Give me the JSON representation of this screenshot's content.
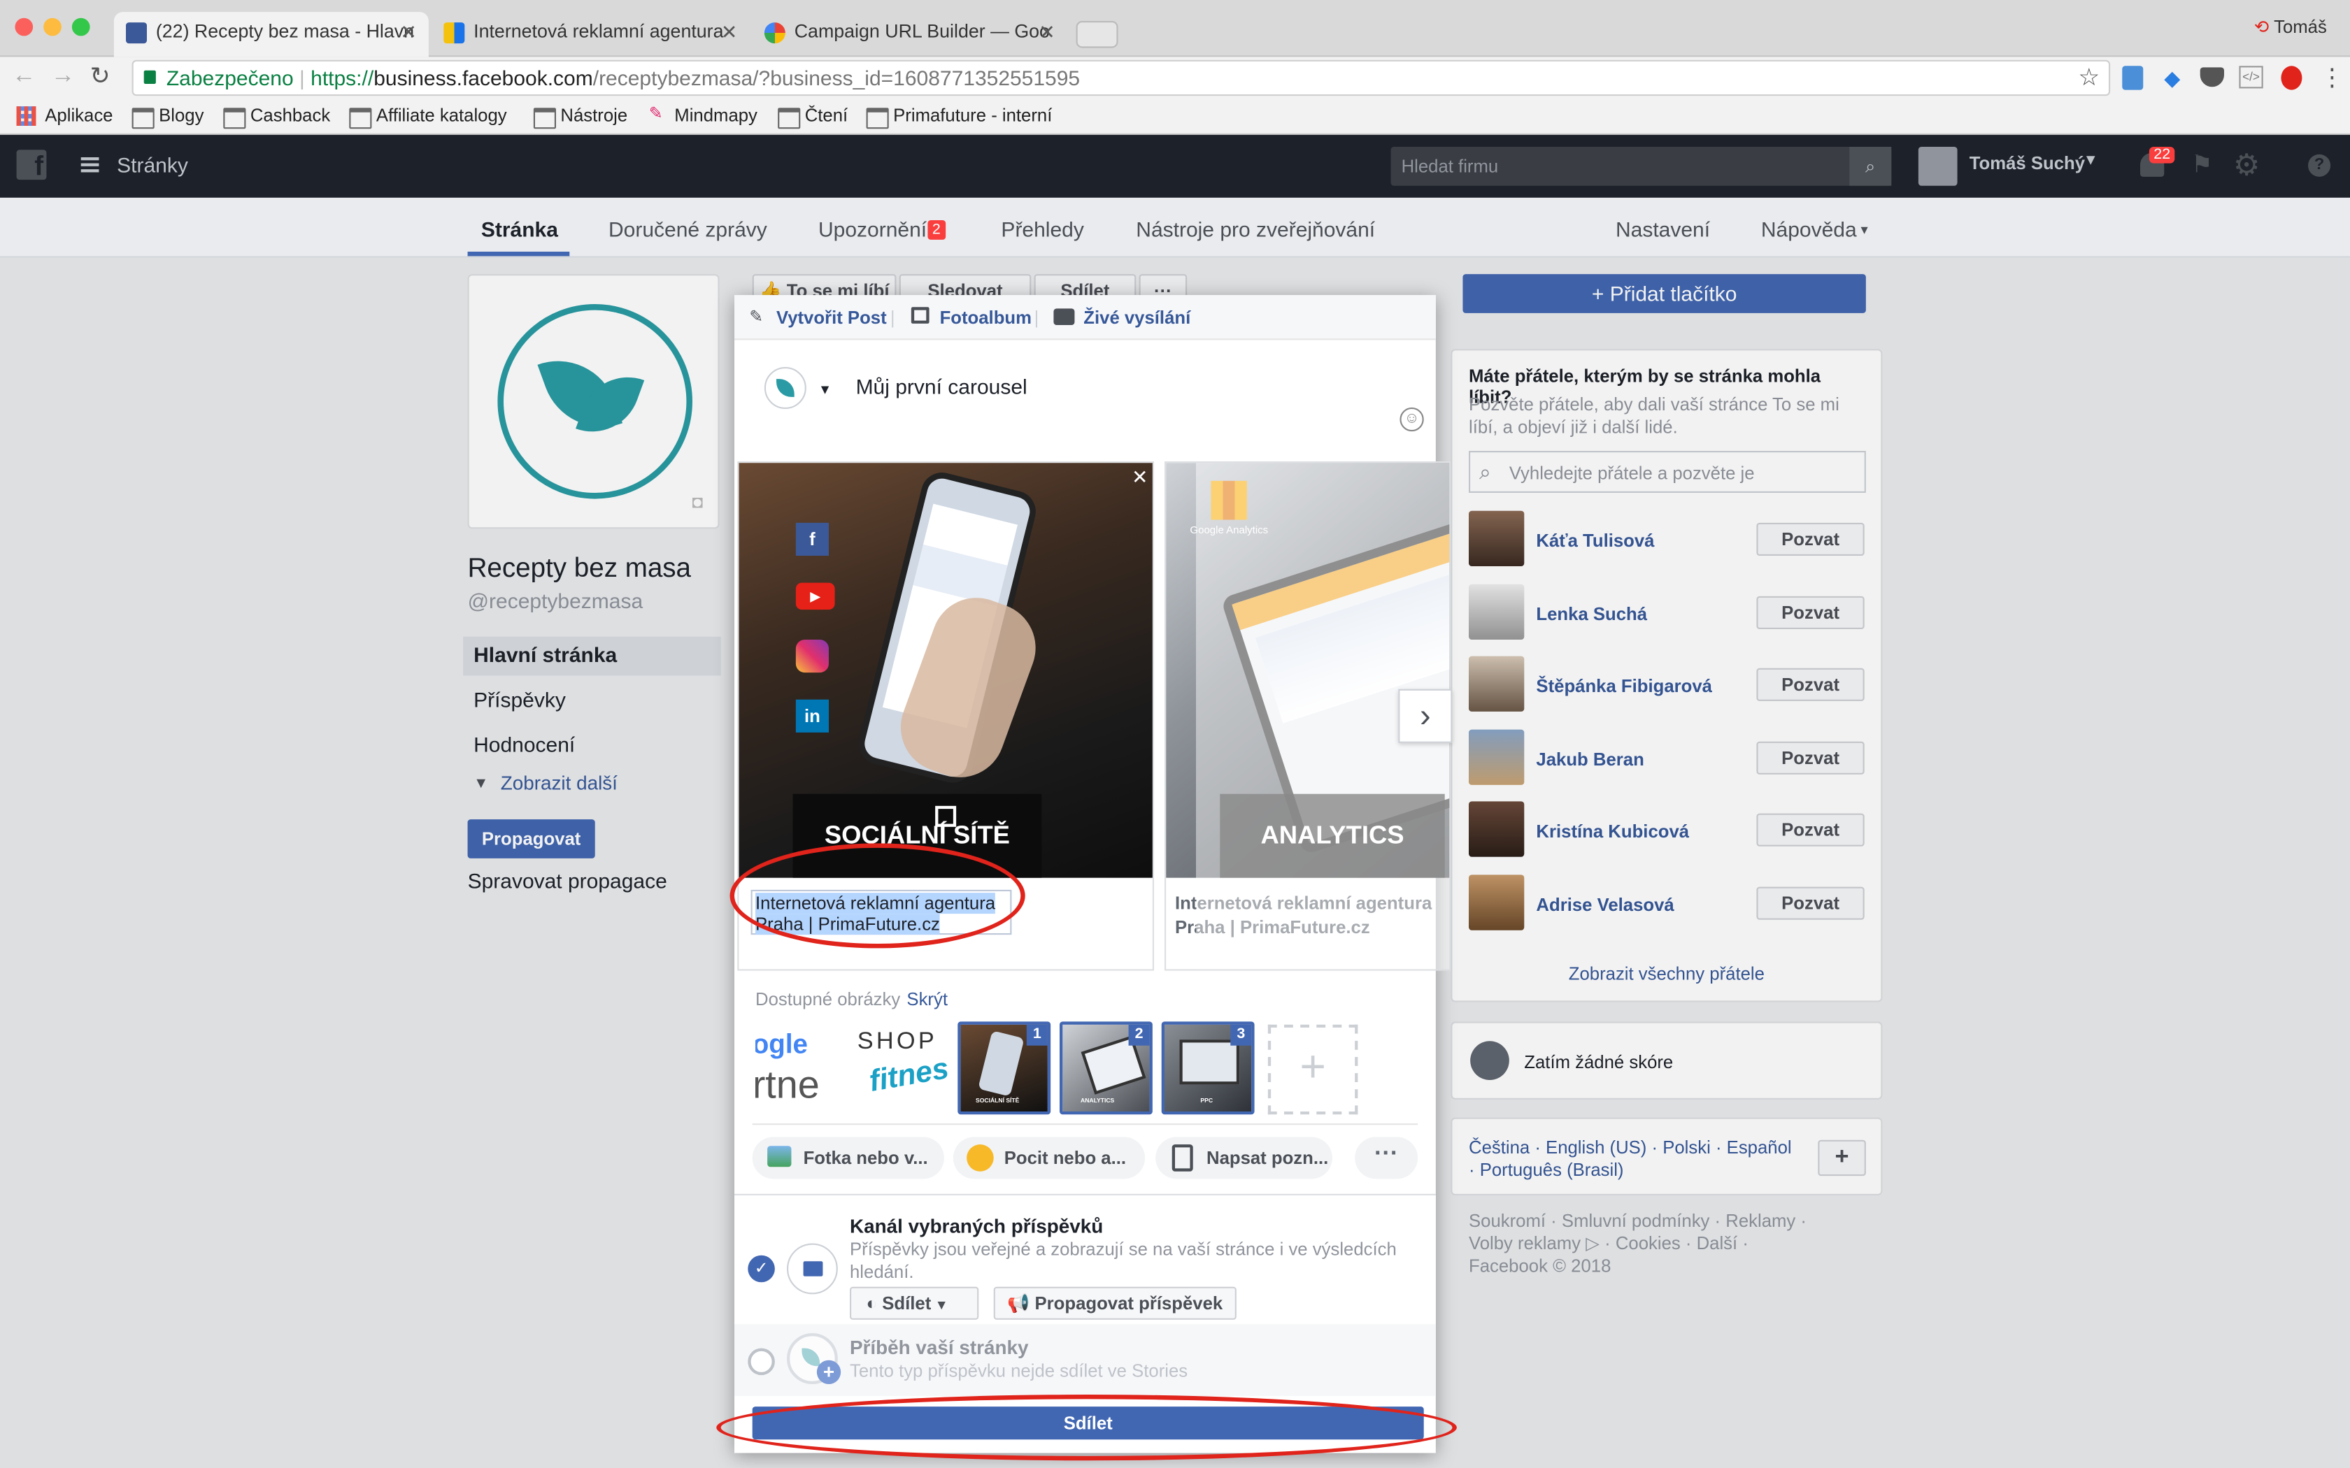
{
  "browser": {
    "tabs": [
      {
        "title": "(22) Recepty bez masa - Hlavn"
      },
      {
        "title": "Internetová reklamní agentura"
      },
      {
        "title": "Campaign URL Builder — Goo"
      }
    ],
    "profile": "Tomáš",
    "secure_label": "Zabezpečeno",
    "url_scheme": "https://",
    "url_host": "business.facebook.com",
    "url_path": "/receptybezmasa/?business_id=1608771352551595",
    "bookmarks": [
      "Aplikace",
      "Blogy",
      "Cashback",
      "Affiliate katalogy",
      "Nástroje",
      "Mindmapy",
      "Čtení",
      "Primafuture - interní"
    ]
  },
  "fb_header": {
    "section": "Stránky",
    "search_placeholder": "Hledat firmu",
    "user": "Tomáš Suchý",
    "notif_count": "22"
  },
  "page_tabs": {
    "stranka": "Stránka",
    "messages": "Doručené zprávy",
    "notifications": "Upozornění",
    "notifications_badge": "2",
    "insights": "Přehledy",
    "tools": "Nástroje pro zveřejňování",
    "settings": "Nastavení",
    "help": "Nápověda"
  },
  "left": {
    "page_name": "Recepty bez masa",
    "handle": "@receptybezmasa",
    "menu": [
      "Hlavní stránka",
      "Příspěvky",
      "Hodnocení"
    ],
    "more": "Zobrazit další",
    "promote": "Propagovat",
    "manage": "Spravovat propagace"
  },
  "under_modal": {
    "like": "To se mi líbí",
    "follow": "Sledovat",
    "share": "Sdílet"
  },
  "right": {
    "add_button": "Přidat tlačítko",
    "invite_title": "Máte přátele, kterým by se stránka mohla líbit?",
    "invite_desc": "Pozvěte přátele, aby dali vaší stránce To se mi líbí, a objeví již i další lidé.",
    "search_placeholder": "Vyhledejte přátele a pozvěte je",
    "friends": [
      {
        "name": "Káťa Tulisová",
        "action": "Pozvat"
      },
      {
        "name": "Lenka Suchá",
        "action": "Pozvat"
      },
      {
        "name": "Štěpánka Fibigarová",
        "action": "Pozvat"
      },
      {
        "name": "Jakub Beran",
        "action": "Pozvat"
      },
      {
        "name": "Kristína Kubicová",
        "action": "Pozvat"
      },
      {
        "name": "Adrise Velasová",
        "action": "Pozvat"
      }
    ],
    "all_friends": "Zobrazit všechny přátele",
    "score": "Zatím žádné skóre",
    "languages": "Čeština · English (US) · Polski · Español · Português (Brasil)",
    "footer": "Soukromí · Smluvní podmínky · Reklamy · Volby reklamy ▷ · Cookies · Další · Facebook © 2018"
  },
  "composer": {
    "tab_post": "Vytvořit Post",
    "tab_album": "Fotoalbum",
    "tab_live": "Živé vysílání",
    "text": "Můj první carousel",
    "card1_label": "SOCIÁLNÍ SÍTĚ",
    "card1_headline": "Internetová reklamní agentura Praha | PrimaFuture.cz",
    "card2_label": "ANALYTICS",
    "card2_headline": "Internetová reklamní agentura Praha | PrimaFuture.cz",
    "card2_brand": "Google Analytics",
    "available_images": "Dostupné obrázky",
    "hide": "Skrýt",
    "thumb_nums": [
      "1",
      "2",
      "3"
    ],
    "thumb_labels": [
      "SOCIÁLNÍ SÍTĚ",
      "ANALYTICS",
      "PPC"
    ],
    "logo_text_1": "ogle",
    "logo_text_2": "rtne",
    "logo_text_3": "SHOP",
    "logo_text_4": "fitnes",
    "action_photo": "Fotka nebo v...",
    "action_feeling": "Pocit nebo a...",
    "action_write": "Napsat pozn...",
    "feed_title": "Kanál vybraných příspěvků",
    "feed_desc": "Příspěvky jsou veřejné a zobrazují se na vaší stránce i ve výsledcích hledání.",
    "feed_share": "Sdílet",
    "feed_promote": "Propagovat příspěvek",
    "story_title": "Příběh vaší stránky",
    "story_desc": "Tento typ příspěvku nejde sdílet ve Stories",
    "submit": "Sdílet"
  },
  "colors": {
    "fb_blue": "#4267b2",
    "link": "#365899",
    "annotation_red": "#e0231b",
    "teal": "#2a9ba4"
  }
}
